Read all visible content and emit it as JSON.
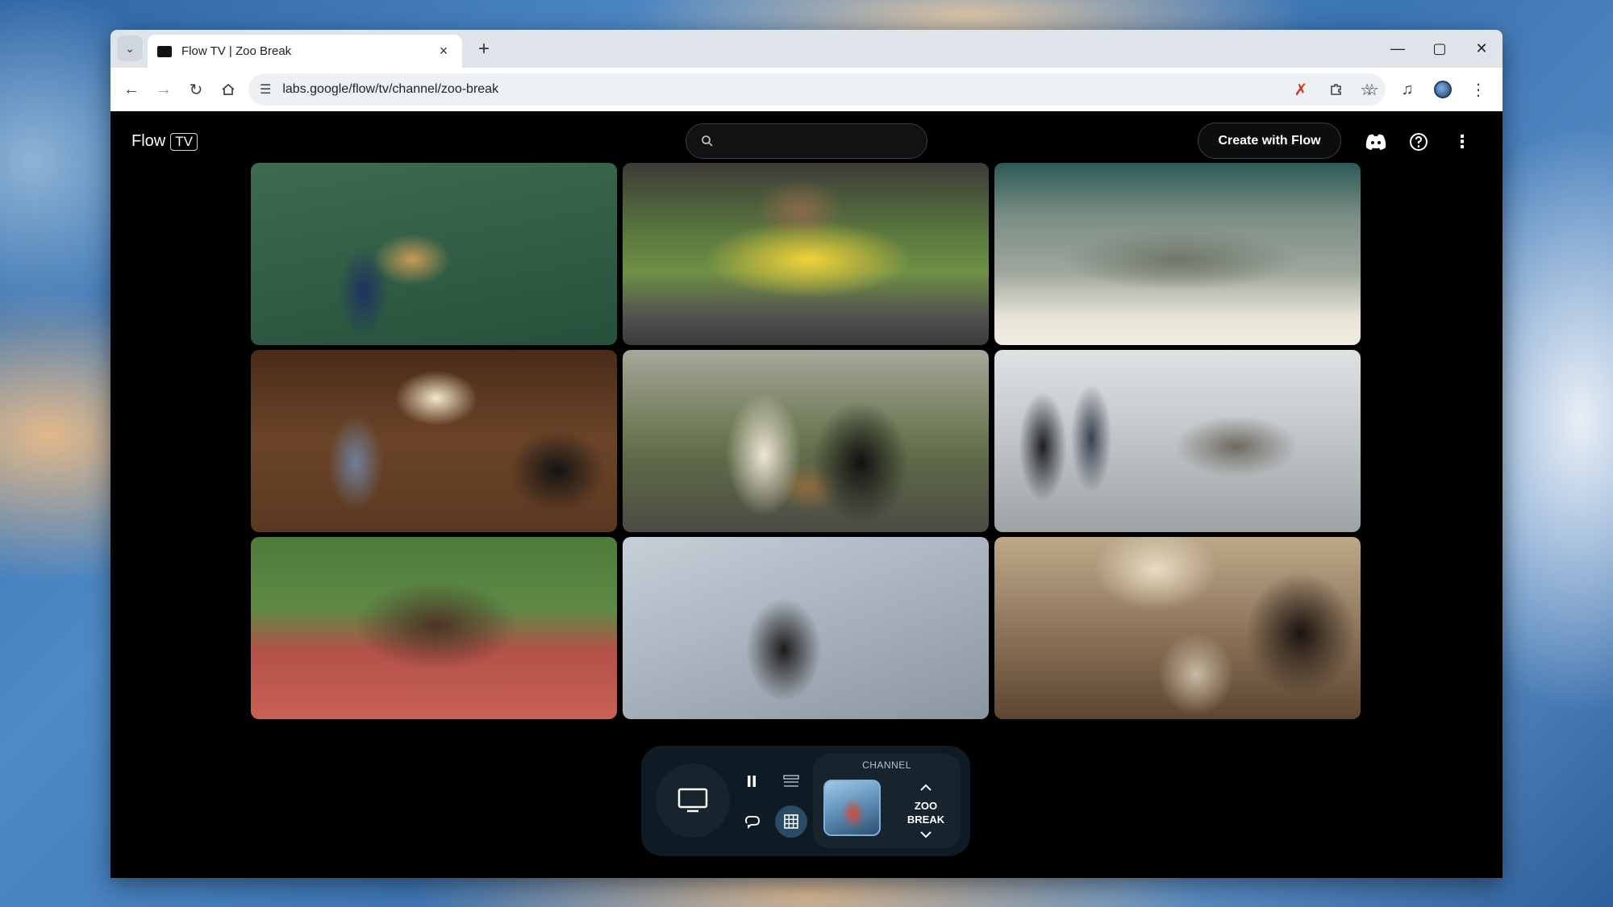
{
  "browser": {
    "tab_title": "Flow TV | Zoo Break",
    "url": "labs.google/flow/tv/channel/zoo-break",
    "icons": [
      "chevron-down-icon",
      "close-icon",
      "plus-icon",
      "minimize-icon",
      "maximize-icon",
      "back-icon",
      "forward-icon",
      "reload-icon",
      "home-icon",
      "tune-icon",
      "star-icon",
      "extension-icon",
      "bookmarks-icon",
      "media-icon",
      "menu-icon"
    ]
  },
  "header": {
    "logo_text": "Flow",
    "logo_badge": "TV",
    "search_placeholder": "",
    "create_button": "Create with Flow"
  },
  "videos": [
    {
      "subject": "cheetah-soccer"
    },
    {
      "subject": "monkeys-race-car"
    },
    {
      "subject": "shark-bathtub"
    },
    {
      "subject": "buffalo-kitchen"
    },
    {
      "subject": "peacock-capybara-panther-swing"
    },
    {
      "subject": "sloth-clothesline"
    },
    {
      "subject": "boar-running-track"
    },
    {
      "subject": "goat-scaffolding"
    },
    {
      "subject": "horse-living-room"
    }
  ],
  "dock": {
    "channel_label": "CHANNEL",
    "channel_name_line1": "ZOO",
    "channel_name_line2": "BREAK"
  }
}
